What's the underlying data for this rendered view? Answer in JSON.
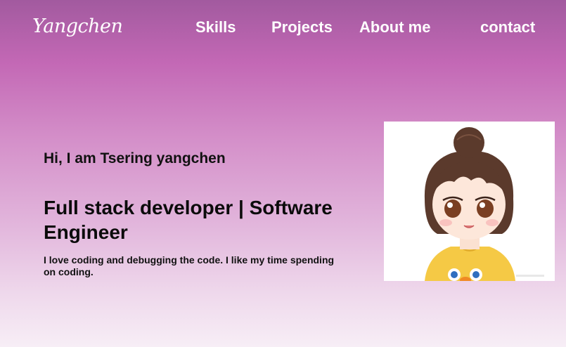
{
  "header": {
    "logo": "Yangchen",
    "nav": [
      {
        "label": "Skills"
      },
      {
        "label": "Projects"
      },
      {
        "label": "About me"
      },
      {
        "label": "contact"
      }
    ]
  },
  "hero": {
    "greeting": "Hi,  I am Tsering yangchen",
    "headline": "Full stack developer | Software Engineer",
    "bio": "I love coding and debugging the code.   I like my time spending on coding.",
    "avatar_icon": "cartoon-girl-avatar"
  },
  "colors": {
    "gradient_top": "#a25a9f",
    "gradient_mid": "#d48fc9",
    "gradient_bottom": "#f7eef6",
    "nav_text": "#ffffff",
    "body_text": "#111111"
  }
}
